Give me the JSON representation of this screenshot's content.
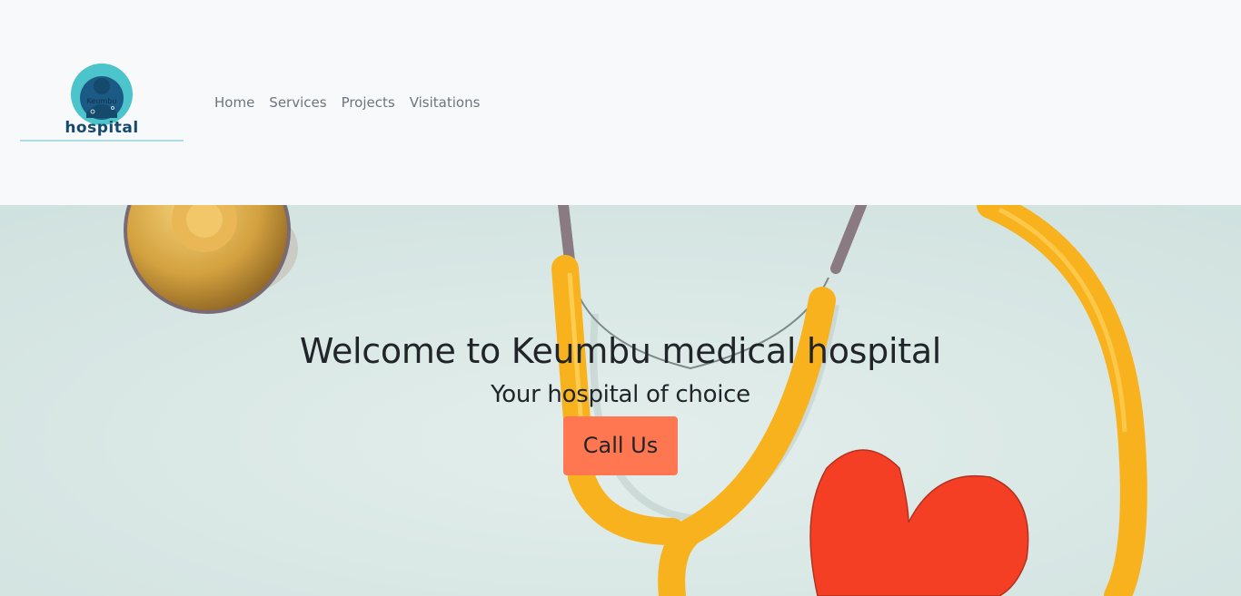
{
  "logo": {
    "badge_text": "Keumbu",
    "word": "hospital"
  },
  "nav": {
    "items": [
      {
        "label": "Home"
      },
      {
        "label": "Services"
      },
      {
        "label": "Projects"
      },
      {
        "label": "Visitations"
      }
    ]
  },
  "hero": {
    "title": "Welcome to Keumbu medical hospital",
    "subtitle": "Your hospital of choice",
    "cta_label": "Call Us"
  },
  "colors": {
    "navbar_bg": "#f8f9fa",
    "hero_bg": "#d9e7e5",
    "cta_bg": "#ff7751",
    "stethoscope": "#f7b21e",
    "heart": "#f53f24",
    "logo_teal": "#4cc4cb",
    "logo_navy": "#164a6d"
  },
  "icons": {
    "logo": "doctor-avatar-icon",
    "hero_image": "stethoscope-heart-photo"
  }
}
